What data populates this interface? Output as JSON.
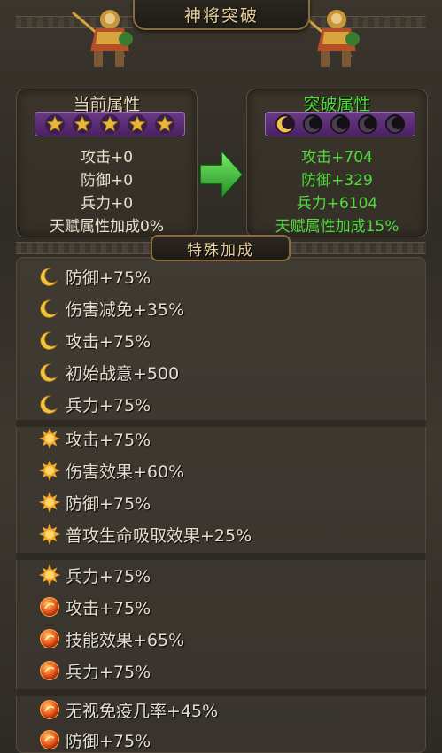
{
  "header": {
    "title": "神将突破"
  },
  "current": {
    "title": "当前属性",
    "stars": 5,
    "stats": [
      "攻击+0",
      "防御+0",
      "兵力+0",
      "天赋属性加成0%"
    ]
  },
  "breakthrough": {
    "title": "突破属性",
    "moons_active": 1,
    "moons_total": 5,
    "stats": [
      "攻击+704",
      "防御+329",
      "兵力+6104",
      "天赋属性加成15%"
    ]
  },
  "special": {
    "title": "特殊加成",
    "items": [
      {
        "icon": "moon-icon",
        "text": "防御+75%"
      },
      {
        "icon": "moon-icon",
        "text": "伤害减免+35%"
      },
      {
        "icon": "moon-icon",
        "text": "攻击+75%"
      },
      {
        "icon": "moon-icon",
        "text": "初始战意+500"
      },
      {
        "icon": "moon-icon",
        "text": "兵力+75%"
      },
      {
        "icon": "sun-icon",
        "text": "攻击+75%"
      },
      {
        "icon": "sun-icon",
        "text": "伤害效果+60%"
      },
      {
        "icon": "sun-icon",
        "text": "防御+75%"
      },
      {
        "icon": "sun-icon",
        "text": "普攻生命吸取效果+25%"
      },
      {
        "icon": "sun-icon",
        "text": "兵力+75%"
      },
      {
        "icon": "fire-orb-icon",
        "text": "攻击+75%"
      },
      {
        "icon": "fire-orb-icon",
        "text": "技能效果+65%"
      },
      {
        "icon": "fire-orb-icon",
        "text": "兵力+75%"
      },
      {
        "icon": "fire-orb-icon",
        "text": "无视免疫几率+45%"
      },
      {
        "icon": "fire-orb-icon",
        "text": "防御+75%"
      }
    ]
  },
  "colors": {
    "gold_text": "#e8cf9a",
    "green_text": "#4fdc3e",
    "purple_bar": "#5a2d74"
  }
}
